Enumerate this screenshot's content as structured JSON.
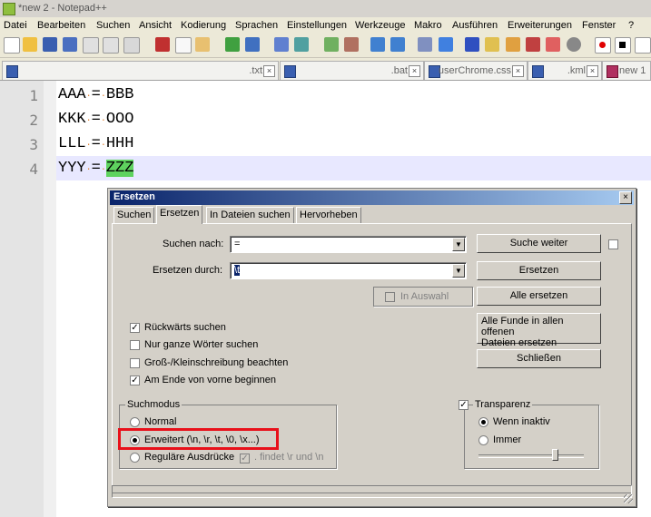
{
  "window": {
    "title": "*new 2 - Notepad++"
  },
  "menu": [
    "Datei",
    "Bearbeiten",
    "Suchen",
    "Ansicht",
    "Kodierung",
    "Sprachen",
    "Einstellungen",
    "Werkzeuge",
    "Makro",
    "Ausführen",
    "Erweiterungen",
    "Fenster",
    "?"
  ],
  "tabs": [
    {
      "name": ".txt"
    },
    {
      "name": ".bat"
    },
    {
      "name": "userChrome.css"
    },
    {
      "name": ".kml"
    },
    {
      "name": "new 1"
    }
  ],
  "editor": {
    "lines": [
      {
        "num": "1",
        "left": "AAA",
        "right": "BBB"
      },
      {
        "num": "2",
        "left": "KKK",
        "right": "OOO"
      },
      {
        "num": "3",
        "left": "LLL",
        "right": "HHH"
      },
      {
        "num": "4",
        "left": "YYY",
        "right": "ZZZ"
      }
    ],
    "operator": "=",
    "current_line": 4
  },
  "dialog": {
    "title": "Ersetzen",
    "close": "×",
    "tabs": [
      "Suchen",
      "Ersetzen",
      "In Dateien suchen",
      "Hervorheben"
    ],
    "active_tab": "Ersetzen",
    "find_label": "Suchen nach:",
    "find_value": "=",
    "replace_label": "Ersetzen durch:",
    "replace_value": "\\t",
    "in_selection": "In Auswahl",
    "buttons": {
      "find_next": "Suche weiter",
      "replace": "Ersetzen",
      "replace_all": "Alle ersetzen",
      "replace_all_open_1": "Alle Funde in allen offenen",
      "replace_all_open_2": "Dateien ersetzen",
      "close": "Schließen"
    },
    "options": [
      {
        "label": "Rückwärts suchen",
        "checked": true
      },
      {
        "label": "Nur ganze Wörter suchen",
        "checked": false
      },
      {
        "label": "Groß-/Kleinschreibung beachten",
        "checked": false
      },
      {
        "label": "Am Ende von vorne beginnen",
        "checked": true
      }
    ],
    "search_mode": {
      "label": "Suchmodus",
      "normal": "Normal",
      "extended": "Erweitert (\\n, \\r, \\t, \\0, \\x...)",
      "regex": "Reguläre Ausdrücke",
      "dot_newline": ". findet \\r und \\n",
      "selected": "extended"
    },
    "transparency": {
      "label": "Transparenz",
      "checked": true,
      "when_inactive": "Wenn inaktiv",
      "always": "Immer",
      "selected": "when_inactive"
    }
  },
  "colors": {
    "highlight": "#5ed35e",
    "current_line": "#e8e8ff",
    "annotation": "#e8101a"
  }
}
